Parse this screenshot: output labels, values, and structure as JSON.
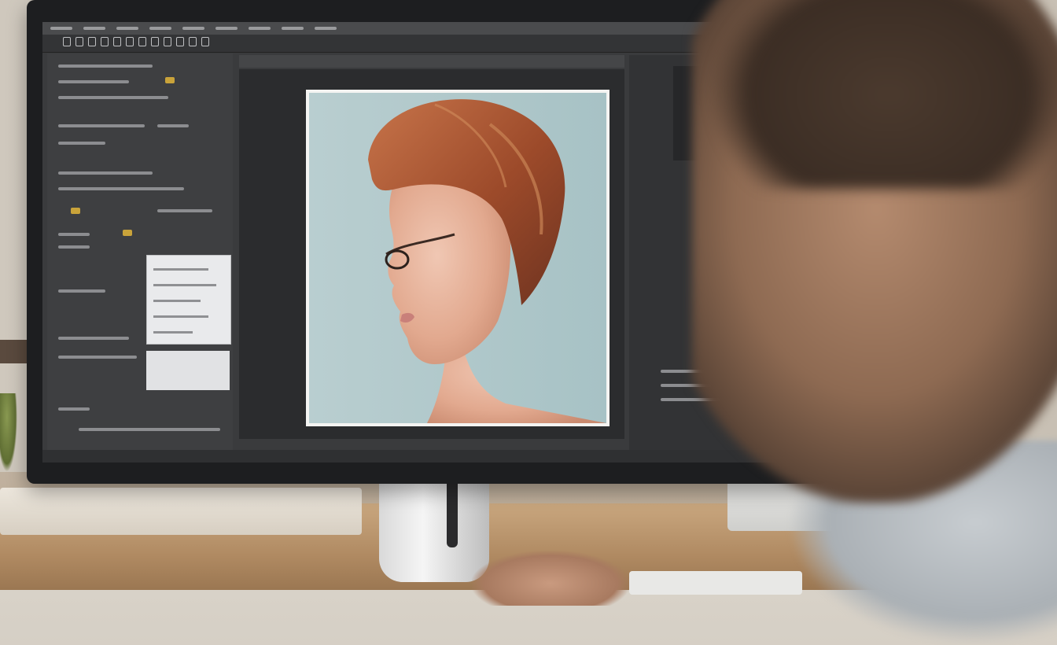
{
  "scene": {
    "description_colors": {
      "wall": "#d8d2c8",
      "desk": "#b08a62",
      "screen_bg": "#3a3b3d",
      "photo_bg": "#aec6c9",
      "hair": "#a8552f",
      "skin": "#e6b8a4"
    }
  },
  "editor": {
    "menu_items": [
      "",
      "",
      "",
      "",
      "",
      "",
      "",
      "",
      ""
    ],
    "tool_icons": [
      "tool-icon",
      "tool-icon",
      "tool-icon",
      "tool-icon",
      "tool-icon",
      "tool-icon",
      "tool-icon",
      "tool-icon",
      "tool-icon",
      "tool-icon",
      "tool-icon",
      "tool-icon"
    ]
  }
}
